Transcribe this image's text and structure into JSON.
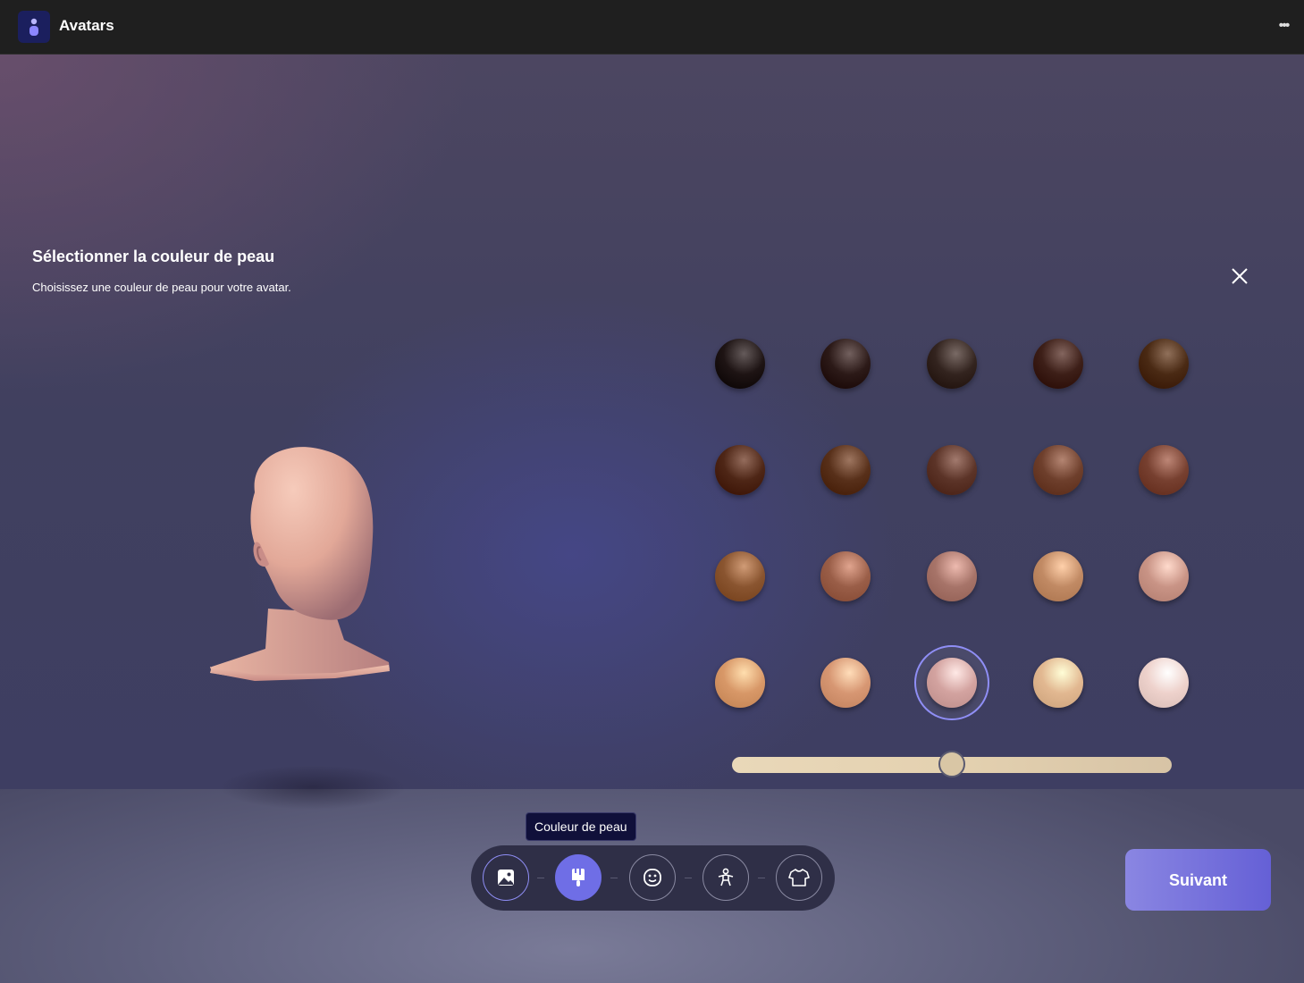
{
  "app": {
    "title": "Avatars",
    "icon": "avatar-app-icon",
    "more_label": "•••"
  },
  "panel": {
    "heading": "Sélectionner la couleur de peau",
    "subheading": "Choisissez une couleur de peau pour votre avatar.",
    "close_icon": "close-icon"
  },
  "skin_tones": {
    "rows": [
      [
        "#1e1414",
        "#2c1a18",
        "#33241f",
        "#3d1f18",
        "#4a2a14"
      ],
      [
        "#4e2616",
        "#58301a",
        "#5c3428",
        "#6e3f2c",
        "#774030"
      ],
      [
        "#8a5530",
        "#9a5e48",
        "#a77469",
        "#c18a64",
        "#c99486"
      ],
      [
        "#d89868",
        "#d79773",
        "#d3a3a0",
        "#e2b891",
        "#eed2cc"
      ]
    ],
    "selected": {
      "row": 3,
      "col": 2
    }
  },
  "shade_slider": {
    "value": 0.5
  },
  "toolbar": {
    "tooltip": "Couleur de peau",
    "steps": [
      {
        "name": "background",
        "icon": "image-icon",
        "state": "done"
      },
      {
        "name": "skin-color",
        "icon": "paintbrush-icon",
        "state": "active"
      },
      {
        "name": "face",
        "icon": "face-icon",
        "state": "inactive"
      },
      {
        "name": "body",
        "icon": "body-icon",
        "state": "inactive"
      },
      {
        "name": "clothing",
        "icon": "shirt-icon",
        "state": "inactive"
      }
    ]
  },
  "actions": {
    "next_label": "Suivant"
  },
  "colors": {
    "accent": "#6f6ee6",
    "titlebar": "#1f1f1f"
  }
}
